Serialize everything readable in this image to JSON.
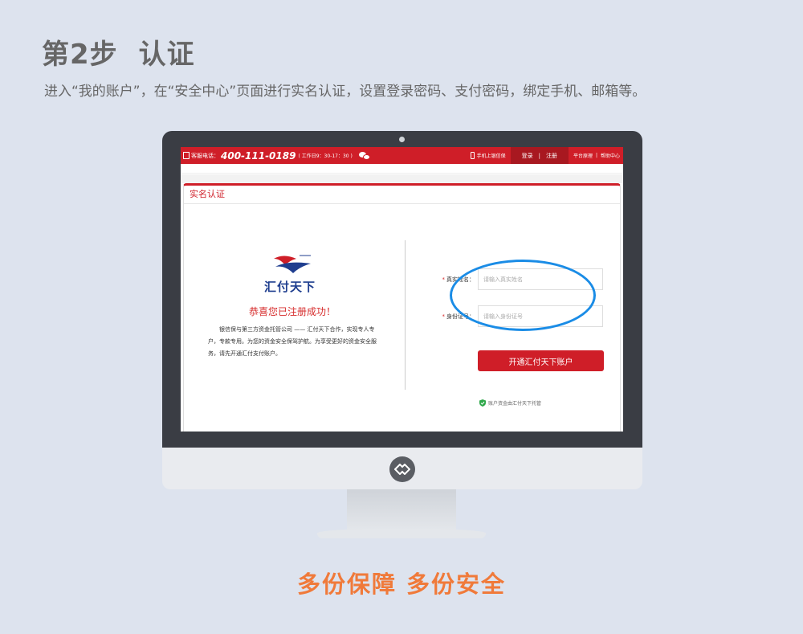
{
  "header": {
    "step_title": "第2步",
    "step_name": "认证",
    "description": "进入“我的账户”，在“安全中心”页面进行实名认证，设置登录密码、支付密码，绑定手机、邮箱等。"
  },
  "topbar": {
    "hotline_label": "客服电话：",
    "hotline_number": "400-111-0189",
    "hours": "( 工作日9：30-17：30 )",
    "mobile_label": "手机上银信保",
    "login": "登录",
    "auth_sep": "|",
    "register": "注册",
    "link_platform": "平台原理",
    "link_sep": "|",
    "link_help": "帮助中心"
  },
  "panel": {
    "title": "实名认证"
  },
  "brand": {
    "name": "汇付天下",
    "congrats": "恭喜您已注册成功！",
    "intro": "银信保与第三方资金托管公司 —— 汇付天下合作，实现专人专户，专款专用。为您的资金安全保驾护航。为享受更好的资金安全服务，请先开通汇付支付账户。"
  },
  "form": {
    "required_mark": "*",
    "name_label": "真实姓名：",
    "name_placeholder": "请输入真实姓名",
    "id_label": "身份证号：",
    "id_placeholder": "请输入身份证号",
    "submit_label": "开通汇付天下账户",
    "custody_note": "账户资金由汇付天下托管"
  },
  "footer": {
    "slogan": "多份保障 多份安全"
  },
  "colors": {
    "accent_red": "#cf1e28",
    "brand_blue": "#1f3e8f",
    "highlight_blue": "#1a8ce6",
    "slogan_orange": "#f07a3a"
  },
  "icons": {
    "hotline": "phone-icon",
    "wechat": "wechat-icon",
    "mobile": "mobile-phone-icon",
    "custody": "shield-check-icon",
    "monitor_logo": "brand-mark-icon"
  }
}
